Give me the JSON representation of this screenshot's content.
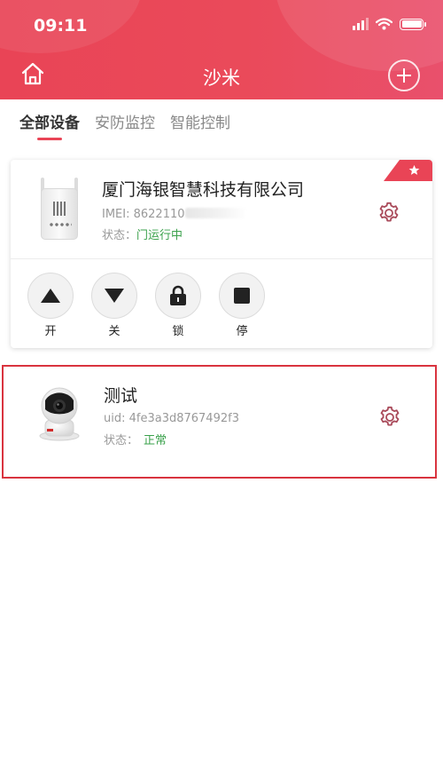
{
  "status_bar": {
    "time": "09:11"
  },
  "header": {
    "title": "沙米",
    "brand_color": "#e94456"
  },
  "tabs": [
    {
      "label": "全部设备",
      "active": true
    },
    {
      "label": "安防监控",
      "active": false
    },
    {
      "label": "智能控制",
      "active": false
    }
  ],
  "devices": [
    {
      "name": "厦门海银智慧科技有限公司",
      "id_label": "IMEI: 8622110",
      "status_label": "状态：",
      "status_value": "门运行中",
      "favorite": true,
      "controls": [
        {
          "label": "开",
          "icon": "arrow-up-icon"
        },
        {
          "label": "关",
          "icon": "arrow-down-icon"
        },
        {
          "label": "锁",
          "icon": "lock-icon"
        },
        {
          "label": "停",
          "icon": "stop-icon"
        }
      ]
    },
    {
      "name": "测试",
      "id_label": "uid: 4fe3a3d8767492f3",
      "status_label": "状态：",
      "status_value": "正常",
      "status_color": "#3aa14b"
    }
  ]
}
